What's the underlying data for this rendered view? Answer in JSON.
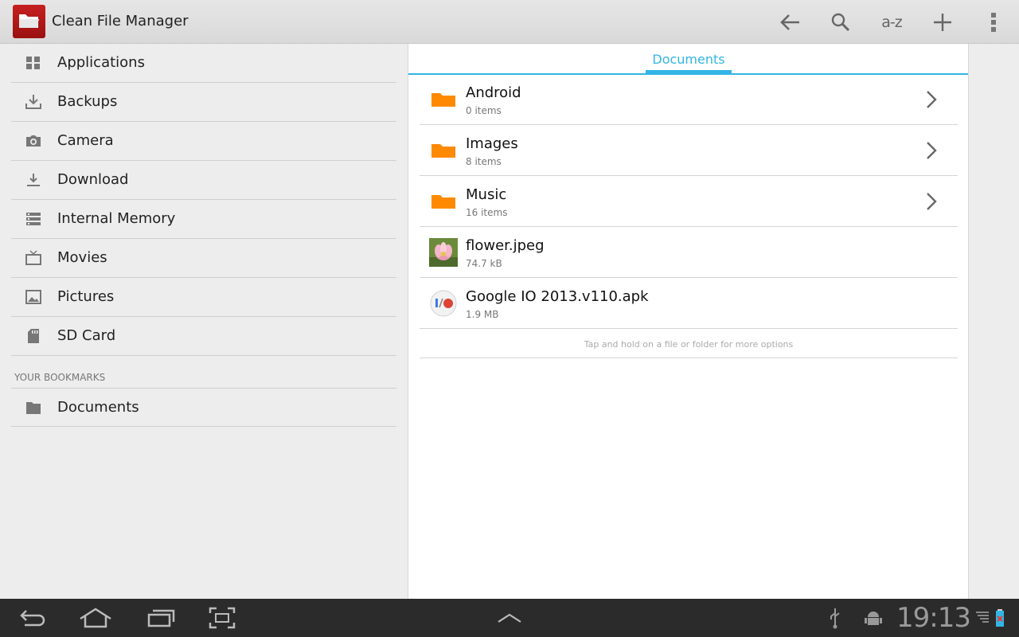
{
  "app": {
    "title": "Clean File Manager"
  },
  "actionbar": {
    "sort_label": "a-z"
  },
  "sidebar": {
    "items": [
      {
        "label": "Applications",
        "icon": "grid-icon"
      },
      {
        "label": "Backups",
        "icon": "backup-download-icon"
      },
      {
        "label": "Camera",
        "icon": "camera-icon"
      },
      {
        "label": "Download",
        "icon": "download-icon"
      },
      {
        "label": "Internal Memory",
        "icon": "storage-icon"
      },
      {
        "label": "Movies",
        "icon": "tv-icon"
      },
      {
        "label": "Pictures",
        "icon": "picture-icon"
      },
      {
        "label": "SD Card",
        "icon": "sd-card-icon"
      }
    ],
    "bookmarks_header": "YOUR BOOKMARKS",
    "bookmarks": [
      {
        "label": "Documents",
        "icon": "folder-icon"
      }
    ]
  },
  "main": {
    "tab": "Documents",
    "files": [
      {
        "name": "Android",
        "meta": "0 items",
        "type": "folder"
      },
      {
        "name": "Images",
        "meta": "8 items",
        "type": "folder"
      },
      {
        "name": "Music",
        "meta": "16 items",
        "type": "folder"
      },
      {
        "name": "flower.jpeg",
        "meta": "74.7 kB",
        "type": "image"
      },
      {
        "name": "Google IO 2013.v110.apk",
        "meta": "1.9 MB",
        "type": "apk"
      }
    ],
    "hint": "Tap and hold on a file or folder for more options"
  },
  "statusbar": {
    "clock": "19:13"
  },
  "colors": {
    "accent": "#33b5e5",
    "folder": "#ff8a00",
    "brand": "#b41616"
  }
}
